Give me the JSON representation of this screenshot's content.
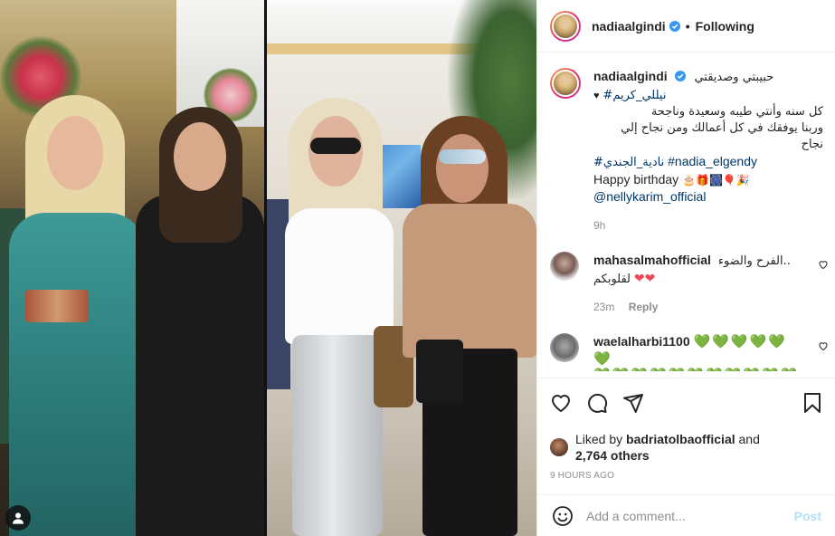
{
  "header": {
    "username": "nadiaalgindi",
    "separator": "•",
    "follow_state": "Following"
  },
  "caption": {
    "username": "nadiaalgindi",
    "line1": "حبيبتي وصديقتي",
    "line2_tag": "#نيللي_كريم",
    "line2_heart": "♥",
    "line3": "كل سنه وأنتي طيبه وسعيدة وناجحة",
    "line4": "وربنا يوفقك في كل أعمالك ومن نجاح إلي",
    "line5": "نجاح",
    "hashtags_ar": "#نادية_الجندي",
    "hashtags_en": "#nadia_elgendy",
    "birthday_text": "Happy birthday",
    "birthday_emojis": "🎂🎁🎆🎈🎉",
    "mention": "@nellykarim_official",
    "time": "9h"
  },
  "comments": [
    {
      "username": "mahasalmahofficial",
      "text_line1": "الفرح والضوء..",
      "text_line2": "لقلوبكم",
      "hearts": "❤❤",
      "time": "23m",
      "reply_label": "Reply"
    },
    {
      "username": "waelalharbi1100",
      "hearts_line1": "💚💚💚💚💚💚",
      "hearts_line2": "💚💚💚💚💚💚💚💚💚💚💚",
      "hearts_line3": "💚💚💚💚💚💚💚💚💚💚💚"
    }
  ],
  "likes": {
    "prefix": "Liked by",
    "user": "badriatolbaofficial",
    "and": "and",
    "count": "2,764 others"
  },
  "timestamp": "9 HOURS AGO",
  "add_comment": {
    "placeholder": "Add a comment...",
    "post_label": "Post"
  },
  "colors": {
    "link": "#00376b",
    "muted": "#8e8e8e",
    "verified": "#3897f0",
    "like_red": "#ed4956",
    "post_disabled": "#b2dffc"
  },
  "icons": [
    "verified-badge-icon",
    "heart-icon",
    "comment-icon",
    "share-icon",
    "bookmark-icon",
    "emoji-icon",
    "user-tag-icon"
  ]
}
